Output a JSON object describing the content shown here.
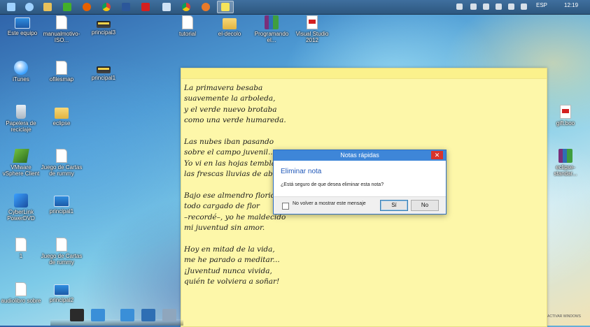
{
  "taskbar": {
    "apps": [
      {
        "name": "start",
        "icon": "windows-start-icon",
        "color": "#9fd2ff"
      },
      {
        "name": "refresh",
        "icon": "refresh-icon",
        "color": "#9fd2ff"
      },
      {
        "name": "explorer",
        "icon": "folder-icon",
        "color": "#e8c15a"
      },
      {
        "name": "evernote",
        "icon": "evernote-icon",
        "color": "#43b02a"
      },
      {
        "name": "firefox",
        "icon": "firefox-icon",
        "color": "#e66000"
      },
      {
        "name": "chrome",
        "icon": "chrome-icon",
        "color": "#e0b900"
      },
      {
        "name": "word",
        "icon": "word-icon",
        "color": "#2b579a"
      },
      {
        "name": "acrobat",
        "icon": "acrobat-icon",
        "color": "#d32020"
      },
      {
        "name": "network",
        "icon": "network-icon",
        "color": "#cfe2f5"
      },
      {
        "name": "chrome2",
        "icon": "chrome-icon",
        "color": "#3aa04a"
      },
      {
        "name": "app",
        "icon": "app-icon",
        "color": "#e87a2a"
      },
      {
        "name": "sticky-notes",
        "icon": "sticky-notes-icon",
        "color": "#f6e45a"
      }
    ],
    "language": "ESP",
    "clock": "12:19"
  },
  "desktop": {
    "icons": [
      {
        "label": "Este equipo",
        "icon": "computer-icon",
        "kind": "monitor"
      },
      {
        "label": "manualmotivo-ISO...",
        "icon": "document-icon",
        "kind": "doc"
      },
      {
        "label": "principal3",
        "icon": "scanner-icon",
        "kind": "scan"
      },
      {
        "label": "iTunes",
        "icon": "itunes-icon",
        "kind": "itunes"
      },
      {
        "label": "ofilesmap",
        "icon": "document-icon",
        "kind": "doc"
      },
      {
        "label": "principal1",
        "icon": "scanner-icon",
        "kind": "scan"
      },
      {
        "label": "Papelera de reciclaje",
        "icon": "recycle-bin-icon",
        "kind": "recycle"
      },
      {
        "label": "eclipse",
        "icon": "folder-icon",
        "kind": "folder"
      },
      {
        "label": "VMware vSphere Client",
        "icon": "vmware-icon",
        "kind": "vmware"
      },
      {
        "label": "Juego de Cartas de rummy",
        "icon": "document-icon",
        "kind": "doc"
      },
      {
        "label": "CyberLink PowerDVD",
        "icon": "cyberlink-icon",
        "kind": "cyber"
      },
      {
        "label": "principal1",
        "icon": "monitor-icon",
        "kind": "monitor"
      },
      {
        "label": "1",
        "icon": "document-icon",
        "kind": "doc"
      },
      {
        "label": "Juego de Cartas de rummy",
        "icon": "document-icon",
        "kind": "doc"
      },
      {
        "label": "audiolibro sobre",
        "icon": "document-icon",
        "kind": "doc"
      },
      {
        "label": "principal2",
        "icon": "monitor-icon",
        "kind": "monitor"
      },
      {
        "label": "tutorial",
        "icon": "document-icon",
        "kind": "doc"
      },
      {
        "label": "el-decolo",
        "icon": "folder-icon",
        "kind": "folder"
      },
      {
        "label": "Programando el...",
        "icon": "winrar-icon",
        "kind": "rar"
      },
      {
        "label": "Visual Studio 2012",
        "icon": "pdf-icon",
        "kind": "pdf"
      },
      {
        "label": "gift.boo",
        "icon": "pdf-icon",
        "kind": "pdf"
      },
      {
        "label": "eclipse-standar...",
        "icon": "winrar-icon",
        "kind": "rar"
      }
    ]
  },
  "note": {
    "lines": [
      "La primavera besaba",
      "suavemente la arboleda,",
      "y el verde nuevo brotaba",
      "como una verde humareda.",
      "",
      "Las nubes iban pasando",
      "sobre el campo juvenil...",
      "Yo vi en las hojas temblando",
      "las frescas lluvias de abril.",
      "",
      "Bajo ese almendro florido,",
      "todo cargado de flor",
      "–recordé–, yo he maldecido",
      "mi juventud sin amor.",
      "",
      "Hoy en mitad de la vida,",
      "me he parado a meditar...",
      "¡Juventud nunca vivida,",
      "quién te volviera a soñar!"
    ]
  },
  "dialog": {
    "title": "Notas rápidas",
    "close": "✕",
    "heading": "Eliminar nota",
    "message": "¿Está seguro de que desea eliminar esta nota?",
    "checkbox_label": "No volver a mostrar este mensaje",
    "yes_label": "Sí",
    "no_label": "No"
  },
  "watermark": "ACTIVAR WINDOWS"
}
